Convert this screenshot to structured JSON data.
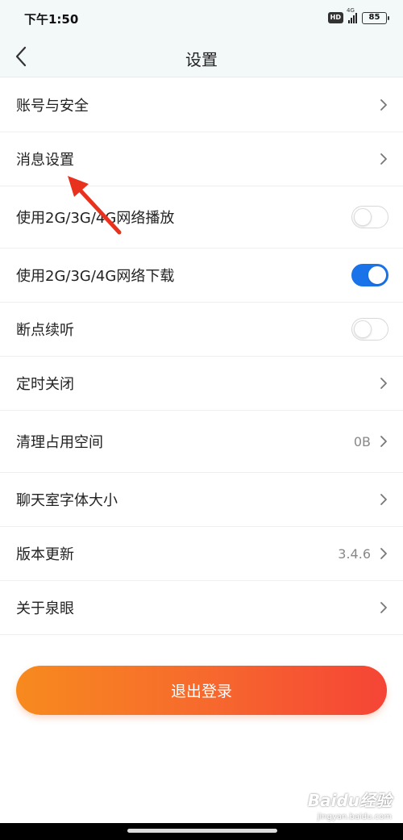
{
  "status_bar": {
    "time": "下午1:50",
    "hd_badge": "HD",
    "network": "4G",
    "battery": "85"
  },
  "nav": {
    "title": "设置",
    "back_icon": "chevron-left-icon"
  },
  "settings": [
    {
      "label": "账号与安全",
      "kind": "link"
    },
    {
      "label": "消息设置",
      "kind": "link"
    },
    {
      "label": "使用2G/3G/4G网络播放",
      "kind": "toggle",
      "checked": false
    },
    {
      "label": "使用2G/3G/4G网络下载",
      "kind": "toggle",
      "checked": true
    },
    {
      "label": "断点续听",
      "kind": "toggle",
      "checked": false
    },
    {
      "label": "定时关闭",
      "kind": "link"
    },
    {
      "label": "清理占用空间",
      "kind": "link",
      "value": "0B"
    },
    {
      "label": "聊天室字体大小",
      "kind": "link"
    },
    {
      "label": "版本更新",
      "kind": "link",
      "value": "3.4.6"
    },
    {
      "label": "关于泉眼",
      "kind": "link"
    }
  ],
  "logout": {
    "label": "退出登录"
  },
  "colors": {
    "toggle_on": "#1a73e8",
    "logout_gradient_start": "#f78a1e",
    "logout_gradient_end": "#f54436",
    "annotation_arrow": "#e8321e"
  },
  "watermark": {
    "logo": "Baidu经验",
    "url": "jingyan.baidu.com"
  }
}
